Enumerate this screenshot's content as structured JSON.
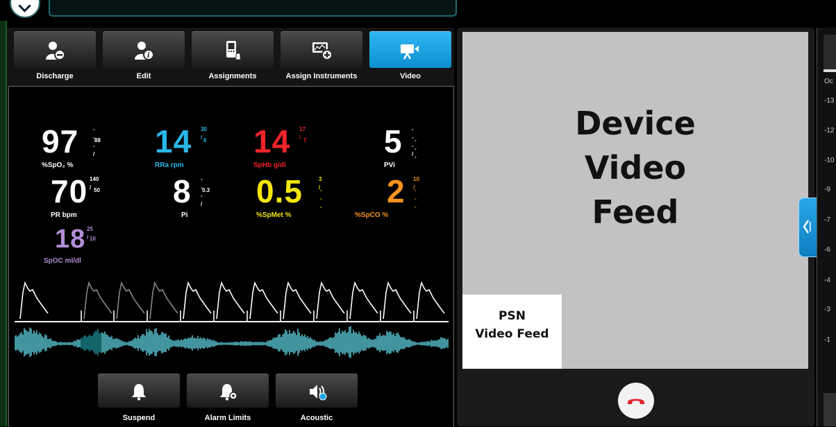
{
  "toolbar": {
    "buttons": [
      {
        "label": "Discharge",
        "icon": "discharge-icon"
      },
      {
        "label": "Edit",
        "icon": "edit-icon"
      },
      {
        "label": "Assignments",
        "icon": "assignments-icon"
      },
      {
        "label": "Assign Instruments",
        "icon": "assign-instruments-icon"
      },
      {
        "label": "Video",
        "icon": "video-icon",
        "active": true
      }
    ]
  },
  "params": {
    "spo2": {
      "value": "97",
      "high": "--- /",
      "low": "88",
      "label": "%SpO₂ %",
      "color": "#ffffff"
    },
    "rra": {
      "value": "14",
      "high": "30 /",
      "low": "6",
      "label": "RRa rpm",
      "color": "#29b6e8"
    },
    "sphb": {
      "value": "14",
      "high": "17 /",
      "low": "7",
      "label": "SpHb g/dl",
      "color": "#f2232a"
    },
    "pvi": {
      "value": "5",
      "high": "--- /",
      "low": "---",
      "label": "PVi",
      "color": "#ffffff"
    },
    "pr": {
      "value": "70",
      "high": "140 /",
      "low": "50",
      "label": "PR bpm",
      "color": "#ffffff"
    },
    "pi": {
      "value": "8",
      "high": "--- /",
      "low": "0.3",
      "label": "Pi",
      "color": "#ffffff"
    },
    "spmet": {
      "value": "0.5",
      "high": "3 /",
      "low": "---",
      "label": "%SpMet %",
      "color": "#f5e60a"
    },
    "spco": {
      "value": "2",
      "high": "10 /",
      "low": "---",
      "label": "%SpCO %",
      "color": "#f7941d"
    },
    "spoc": {
      "value": "18",
      "high": "25 /",
      "low": "10",
      "label": "SpOC ml/dl",
      "color": "#b18fd6"
    }
  },
  "bottom_buttons": [
    {
      "label": "Suspend",
      "icon": "bell-icon"
    },
    {
      "label": "Alarm Limits",
      "icon": "alarm-limits-icon"
    },
    {
      "label": "Acoustic",
      "icon": "acoustic-icon"
    }
  ],
  "video": {
    "device_line1": "Device",
    "device_line2": "Video",
    "device_line3": "Feed",
    "psn_line1": "PSN",
    "psn_line2": "Video Feed"
  },
  "right_strip": {
    "header": "Oc",
    "ticks": [
      "-13",
      "-12",
      "-10",
      "-9",
      "-7",
      "-6",
      "-4",
      "-3",
      "-1"
    ]
  },
  "colors": {
    "accent": "#1ea6ea",
    "pleth": "#ffffff",
    "acoustic": "#5fd3e3",
    "hangup": "#e0242f"
  }
}
